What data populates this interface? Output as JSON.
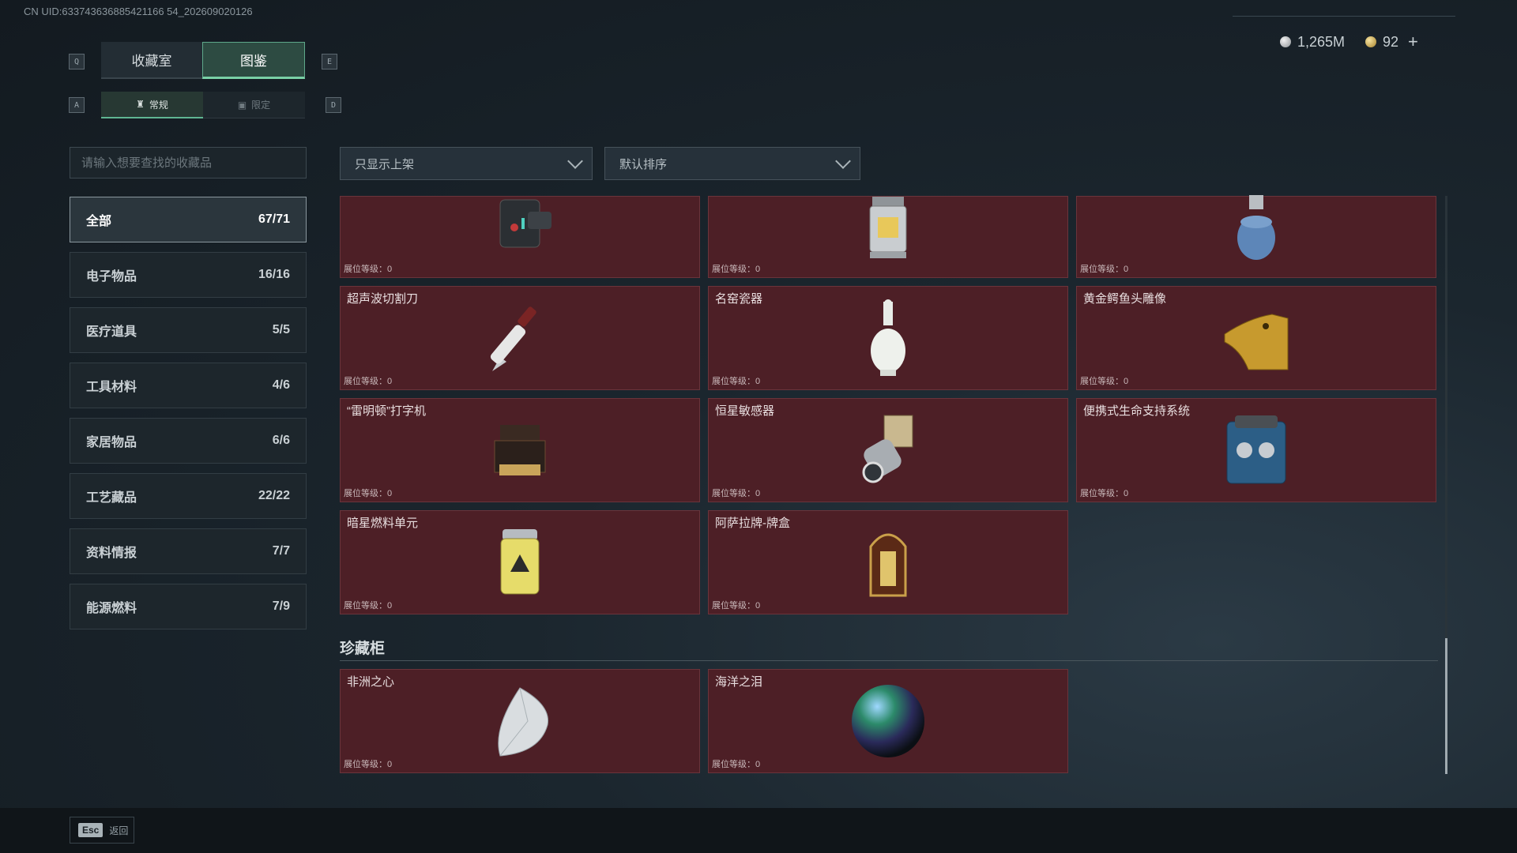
{
  "header": {
    "uid": "CN UID:633743636885421166 54_202609020126",
    "currency_silver": "1,265M",
    "currency_gold": "92",
    "plus": "+"
  },
  "tabs": {
    "key_left": "Q",
    "key_right": "E",
    "items": [
      {
        "label": "收藏室",
        "active": false
      },
      {
        "label": "图鉴",
        "active": true
      }
    ]
  },
  "subtabs": {
    "key_left": "A",
    "key_right": "D",
    "items": [
      {
        "label": "常规",
        "active": true
      },
      {
        "label": "限定",
        "active": false
      }
    ]
  },
  "search": {
    "placeholder": "请输入想要查找的收藏品"
  },
  "filters": {
    "show_filter": "只显示上架",
    "sort": "默认排序"
  },
  "categories": [
    {
      "label": "全部",
      "count": "67/71",
      "active": true
    },
    {
      "label": "电子物品",
      "count": "16/16"
    },
    {
      "label": "医疗道具",
      "count": "5/5"
    },
    {
      "label": "工具材料",
      "count": "4/6"
    },
    {
      "label": "家居物品",
      "count": "6/6"
    },
    {
      "label": "工艺藏品",
      "count": "22/22"
    },
    {
      "label": "资料情报",
      "count": "7/7"
    },
    {
      "label": "能源燃料",
      "count": "7/9"
    }
  ],
  "level_label": "展位等级：0",
  "items": [
    {
      "name": "",
      "icon": "wrist-device-icon"
    },
    {
      "name": "",
      "icon": "lantern-icon"
    },
    {
      "name": "",
      "icon": "gas-canister-icon"
    },
    {
      "name": "超声波切割刀",
      "icon": "ultrasonic-knife-icon"
    },
    {
      "name": "名窑瓷器",
      "icon": "porcelain-vase-icon"
    },
    {
      "name": "黄金鳄鱼头雕像",
      "icon": "golden-crocodile-icon"
    },
    {
      "name": "“雷明顿”打字机",
      "icon": "typewriter-icon"
    },
    {
      "name": "恒星敏感器",
      "icon": "star-sensor-icon"
    },
    {
      "name": "便携式生命支持系统",
      "icon": "life-support-icon"
    },
    {
      "name": "暗星燃料单元",
      "icon": "fuel-cell-icon"
    },
    {
      "name": "阿萨拉牌-牌盒",
      "icon": "card-box-icon"
    }
  ],
  "section2": {
    "title": "珍藏柜",
    "items": [
      {
        "name": "非洲之心",
        "icon": "diamond-icon"
      },
      {
        "name": "海洋之泪",
        "icon": "pearl-icon"
      }
    ]
  },
  "footer": {
    "esc": "Esc",
    "back": "返回"
  }
}
